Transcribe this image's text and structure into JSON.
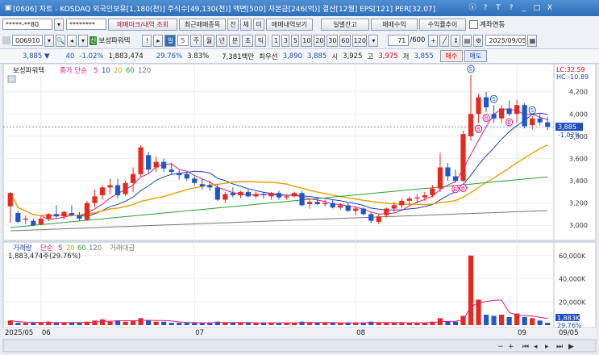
{
  "window": {
    "title": "[0606] 차트 - KOSDAQ 외국인보유[1,180(천)] 주식수[49,130(천)] 액면[500] 자본금[246(억)] 결산[12월] EPS[121] PER[32.07]",
    "controls": [
      "ⓢ",
      "?",
      "T",
      "?",
      "_",
      "□",
      "X"
    ]
  },
  "toolbar1": {
    "account": "*****-**80",
    "password": "********",
    "buttons": [
      "매매마크/내역 조회",
      "최근매매종목",
      "잔",
      "체",
      "미",
      "매매내역보기",
      "일별잔고",
      "매매수익",
      "수익률추이"
    ],
    "checkbox_label": "계좌연동"
  },
  "toolbar2": {
    "code": "006910",
    "name": "보성파워텍",
    "period_selected": "일",
    "period_count": "5",
    "periods": [
      "주",
      "월",
      "년",
      "분",
      "초",
      "틱"
    ],
    "ranges": [
      "1",
      "3",
      "5",
      "10",
      "20",
      "30",
      "60",
      "120"
    ],
    "view_count": "71",
    "view_total": "/600",
    "date": "2025/09/05"
  },
  "quote": {
    "price": "3,885 ▼",
    "change": "40",
    "change_rate": "-1.02%",
    "volume": "1,883,474",
    "volume_ratio": "29.76%",
    "turnover": "3.83%",
    "amount": "7,381백만",
    "best_ask_label": "최우선",
    "best_ask": "3,890",
    "best_bid": "3,885",
    "open_label": "시",
    "open": "3,925",
    "high_label": "고",
    "high": "3,975",
    "low_label": "저",
    "low": "3,855",
    "buy_label": "매수",
    "sell_label": "매도"
  },
  "price_pane": {
    "legend_name": "보성파워텍",
    "legend_ma": "종가 단순",
    "ma_periods": [
      "5",
      "10",
      "20",
      "60",
      "120"
    ],
    "ma_colors": [
      "#e0197d",
      "#1f3fbf",
      "#e8a000",
      "#2e9b3a",
      "#777777"
    ],
    "lc_label": "LC:32.59",
    "hc_label": "HC:-10.89",
    "current_price_label": "3,885",
    "current_change_label": "-1.02%",
    "y_ticks": [
      "4,200",
      "4,000",
      "3,800",
      "3,600",
      "3,400",
      "3,200",
      "3,000"
    ],
    "buy_marker": "B",
    "sell_marker": "S"
  },
  "volume_pane": {
    "legend_name": "거래량",
    "legend_ma": "단순",
    "ma_periods": [
      "5",
      "20",
      "60",
      "120"
    ],
    "legend_extra": "거래대금",
    "value_label": "1,883,474주(29.76%)",
    "current_label": "1,883K",
    "current_rate": "29.76%",
    "y_ticks": [
      "60,000K",
      "40,000K",
      "20,000K"
    ]
  },
  "x_axis": {
    "start_label": "2025/05",
    "ticks": [
      "06",
      "07",
      "08",
      "09"
    ],
    "end_label": "09/05"
  },
  "chart_data": {
    "type": "candlestick",
    "x_labels": [
      "2025/05",
      "06",
      "07",
      "08",
      "09",
      "09/05"
    ],
    "y_range": [
      2900,
      4350
    ],
    "candles": [
      {
        "o": 3170,
        "h": 3300,
        "l": 3020,
        "c": 3290
      },
      {
        "o": 3110,
        "h": 3130,
        "l": 3020,
        "c": 3030
      },
      {
        "o": 3050,
        "h": 3090,
        "l": 3010,
        "c": 3060
      },
      {
        "o": 3040,
        "h": 3060,
        "l": 2990,
        "c": 3000
      },
      {
        "o": 3010,
        "h": 3080,
        "l": 3000,
        "c": 3060
      },
      {
        "o": 3060,
        "h": 3110,
        "l": 3040,
        "c": 3100
      },
      {
        "o": 3100,
        "h": 3180,
        "l": 3060,
        "c": 3080
      },
      {
        "o": 3080,
        "h": 3130,
        "l": 3050,
        "c": 3120
      },
      {
        "o": 3110,
        "h": 3180,
        "l": 3080,
        "c": 3090
      },
      {
        "o": 3090,
        "h": 3120,
        "l": 3040,
        "c": 3060
      },
      {
        "o": 3050,
        "h": 3220,
        "l": 3040,
        "c": 3200
      },
      {
        "o": 3200,
        "h": 3320,
        "l": 3160,
        "c": 3260
      },
      {
        "o": 3270,
        "h": 3360,
        "l": 3230,
        "c": 3340
      },
      {
        "o": 3340,
        "h": 3420,
        "l": 3280,
        "c": 3360
      },
      {
        "o": 3360,
        "h": 3420,
        "l": 3240,
        "c": 3270
      },
      {
        "o": 3280,
        "h": 3400,
        "l": 3260,
        "c": 3380
      },
      {
        "o": 3380,
        "h": 3520,
        "l": 3300,
        "c": 3460
      },
      {
        "o": 3460,
        "h": 3720,
        "l": 3440,
        "c": 3700
      },
      {
        "o": 3630,
        "h": 3660,
        "l": 3470,
        "c": 3500
      },
      {
        "o": 3520,
        "h": 3620,
        "l": 3480,
        "c": 3570
      },
      {
        "o": 3570,
        "h": 3600,
        "l": 3480,
        "c": 3510
      },
      {
        "o": 3500,
        "h": 3560,
        "l": 3460,
        "c": 3480
      },
      {
        "o": 3470,
        "h": 3500,
        "l": 3410,
        "c": 3450
      },
      {
        "o": 3460,
        "h": 3480,
        "l": 3400,
        "c": 3420
      },
      {
        "o": 3420,
        "h": 3440,
        "l": 3360,
        "c": 3380
      },
      {
        "o": 3370,
        "h": 3420,
        "l": 3320,
        "c": 3350
      },
      {
        "o": 3360,
        "h": 3400,
        "l": 3310,
        "c": 3340
      },
      {
        "o": 3340,
        "h": 3370,
        "l": 3220,
        "c": 3230
      },
      {
        "o": 3230,
        "h": 3300,
        "l": 3200,
        "c": 3280
      },
      {
        "o": 3290,
        "h": 3340,
        "l": 3250,
        "c": 3270
      },
      {
        "o": 3270,
        "h": 3310,
        "l": 3240,
        "c": 3300
      },
      {
        "o": 3300,
        "h": 3320,
        "l": 3250,
        "c": 3260
      },
      {
        "o": 3260,
        "h": 3300,
        "l": 3240,
        "c": 3280
      },
      {
        "o": 3280,
        "h": 3300,
        "l": 3240,
        "c": 3270
      },
      {
        "o": 3260,
        "h": 3300,
        "l": 3230,
        "c": 3290
      },
      {
        "o": 3290,
        "h": 3310,
        "l": 3230,
        "c": 3250
      },
      {
        "o": 3250,
        "h": 3280,
        "l": 3230,
        "c": 3260
      },
      {
        "o": 3260,
        "h": 3300,
        "l": 3250,
        "c": 3290
      },
      {
        "o": 3290,
        "h": 3310,
        "l": 3170,
        "c": 3180
      },
      {
        "o": 3190,
        "h": 3230,
        "l": 3150,
        "c": 3210
      },
      {
        "o": 3210,
        "h": 3240,
        "l": 3180,
        "c": 3190
      },
      {
        "o": 3190,
        "h": 3230,
        "l": 3170,
        "c": 3200
      },
      {
        "o": 3200,
        "h": 3230,
        "l": 3150,
        "c": 3160
      },
      {
        "o": 3160,
        "h": 3200,
        "l": 3140,
        "c": 3180
      },
      {
        "o": 3180,
        "h": 3200,
        "l": 3120,
        "c": 3130
      },
      {
        "o": 3130,
        "h": 3170,
        "l": 3090,
        "c": 3150
      },
      {
        "o": 3150,
        "h": 3160,
        "l": 3090,
        "c": 3100
      },
      {
        "o": 3100,
        "h": 3120,
        "l": 3020,
        "c": 3040
      },
      {
        "o": 3030,
        "h": 3100,
        "l": 3010,
        "c": 3080
      },
      {
        "o": 3090,
        "h": 3160,
        "l": 3070,
        "c": 3150
      },
      {
        "o": 3150,
        "h": 3210,
        "l": 3120,
        "c": 3180
      },
      {
        "o": 3180,
        "h": 3240,
        "l": 3150,
        "c": 3220
      },
      {
        "o": 3220,
        "h": 3260,
        "l": 3180,
        "c": 3240
      },
      {
        "o": 3240,
        "h": 3280,
        "l": 3200,
        "c": 3250
      },
      {
        "o": 3250,
        "h": 3300,
        "l": 3220,
        "c": 3270
      },
      {
        "o": 3270,
        "h": 3360,
        "l": 3250,
        "c": 3330
      },
      {
        "o": 3330,
        "h": 3650,
        "l": 3300,
        "c": 3520
      },
      {
        "o": 3520,
        "h": 3560,
        "l": 3400,
        "c": 3440
      },
      {
        "o": 3440,
        "h": 3500,
        "l": 3380,
        "c": 3400
      },
      {
        "o": 3400,
        "h": 3850,
        "l": 3390,
        "c": 3820
      },
      {
        "o": 3800,
        "h": 4350,
        "l": 3760,
        "c": 4000
      },
      {
        "o": 4000,
        "h": 4180,
        "l": 3920,
        "c": 4150
      },
      {
        "o": 4150,
        "h": 4200,
        "l": 4020,
        "c": 4060
      },
      {
        "o": 4000,
        "h": 4080,
        "l": 3920,
        "c": 3960
      },
      {
        "o": 3960,
        "h": 4080,
        "l": 3920,
        "c": 4050
      },
      {
        "o": 4050,
        "h": 4120,
        "l": 3980,
        "c": 4000
      },
      {
        "o": 4000,
        "h": 4130,
        "l": 3920,
        "c": 4080
      },
      {
        "o": 4080,
        "h": 4100,
        "l": 3870,
        "c": 3890
      },
      {
        "o": 3900,
        "h": 3980,
        "l": 3860,
        "c": 3960
      },
      {
        "o": 3960,
        "h": 4000,
        "l": 3900,
        "c": 3925
      },
      {
        "o": 3925,
        "h": 3975,
        "l": 3855,
        "c": 3885
      }
    ],
    "volume": [
      4,
      2,
      2,
      2,
      2,
      3,
      2,
      2,
      2,
      2,
      3,
      4,
      5,
      3,
      4,
      3,
      4,
      6,
      4,
      3,
      3,
      2,
      2,
      2,
      2,
      2,
      2,
      3,
      2,
      2,
      2,
      2,
      2,
      2,
      2,
      2,
      2,
      2,
      3,
      2,
      2,
      2,
      2,
      2,
      2,
      2,
      2,
      3,
      2,
      2,
      2,
      2,
      2,
      2,
      2,
      3,
      6,
      3,
      3,
      8,
      60,
      22,
      9,
      8,
      9,
      7,
      10,
      7,
      6,
      4,
      2
    ],
    "volume_unit": "K shares",
    "markers": [
      {
        "i": 58,
        "t": "B"
      },
      {
        "i": 59,
        "t": "B"
      },
      {
        "i": 60,
        "t": "S"
      },
      {
        "i": 61,
        "t": "B"
      },
      {
        "i": 62,
        "t": "B"
      },
      {
        "i": 63,
        "t": "S"
      },
      {
        "i": 65,
        "t": "B"
      },
      {
        "i": 68,
        "t": "S"
      }
    ]
  }
}
